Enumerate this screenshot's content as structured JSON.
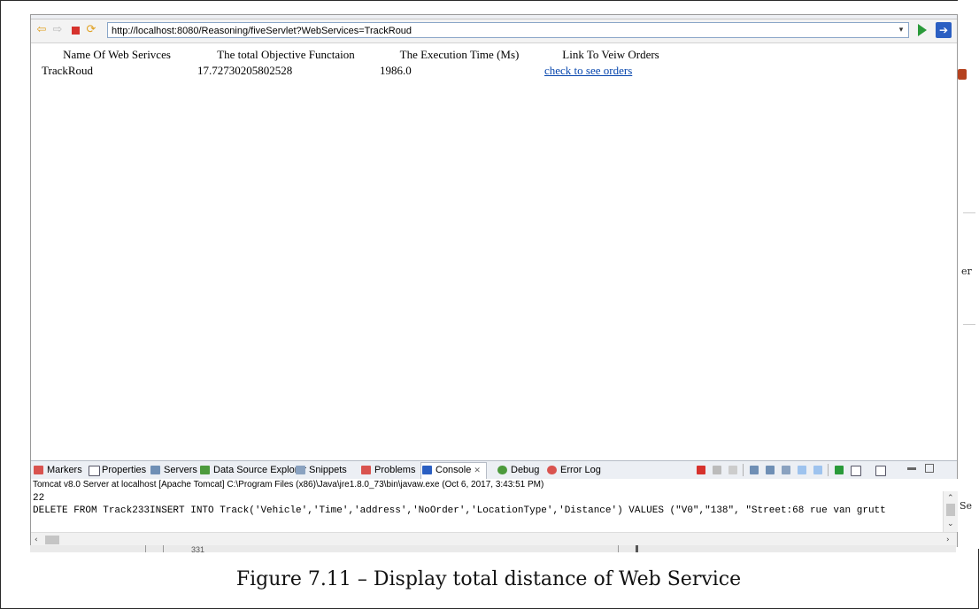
{
  "browser": {
    "url": "http://localhost:8080/Reasoning/fiveServlet?WebServices=TrackRoud",
    "table": {
      "headers": [
        "Name Of Web Serivces",
        "The total Objective Functaion",
        "The Execution Time (Ms)",
        "Link To Veiw Orders"
      ],
      "rows": [
        {
          "name": "TrackRoud",
          "objective": "17.72730205802528",
          "time": "1986.0",
          "link": "check to see orders"
        }
      ]
    }
  },
  "views": {
    "tabs": [
      "Markers",
      "Properties",
      "Servers",
      "Data Source Explorer",
      "Snippets",
      "Problems",
      "Console",
      "Debug",
      "Error Log"
    ],
    "active": "Console",
    "close_glyph": "✕"
  },
  "console": {
    "info": "Tomcat v8.0 Server at localhost [Apache Tomcat] C:\\Program Files (x86)\\Java\\jre1.8.0_73\\bin\\javaw.exe (Oct 6, 2017, 3:43:51 PM)",
    "lines": [
      "22",
      "DELETE FROM Track233INSERT INTO Track('Vehicle','Time','address','NoOrder','LocationType','Distance') VALUES (\"V0\",\"138\", \"Street:68 rue van grutt"
    ]
  },
  "under_text": "331",
  "right_clips": [
    "er",
    "Se"
  ],
  "caption": "Figure 7.11 – Display total distance of Web Service",
  "colors": {
    "accent": "#2b5fc2",
    "link": "#0645ad",
    "stop": "#d6322d",
    "go": "#2a9a3a"
  }
}
